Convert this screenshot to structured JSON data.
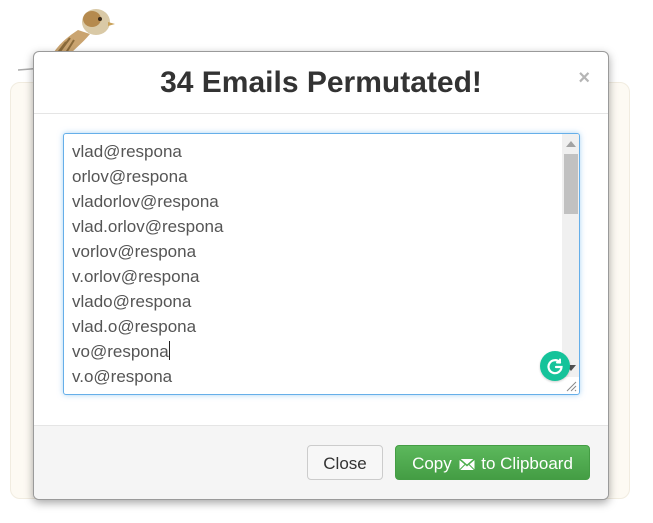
{
  "modal": {
    "title": "34 Emails Permutated!",
    "close_glyph": "×"
  },
  "emails": [
    "vlad@respona",
    "orlov@respona",
    "vladorlov@respona",
    "vlad.orlov@respona",
    "vorlov@respona",
    "v.orlov@respona",
    "vlado@respona",
    "vlad.o@respona",
    "vo@respona",
    "v.o@respona"
  ],
  "footer": {
    "close_label": "Close",
    "copy_label_before": "Copy",
    "copy_label_after": "to Clipboard",
    "copy_icon": "envelope-icon"
  },
  "colors": {
    "primary_button": "#5cb85c",
    "focus_border": "#66afe9",
    "grammarly": "#15c39a"
  }
}
